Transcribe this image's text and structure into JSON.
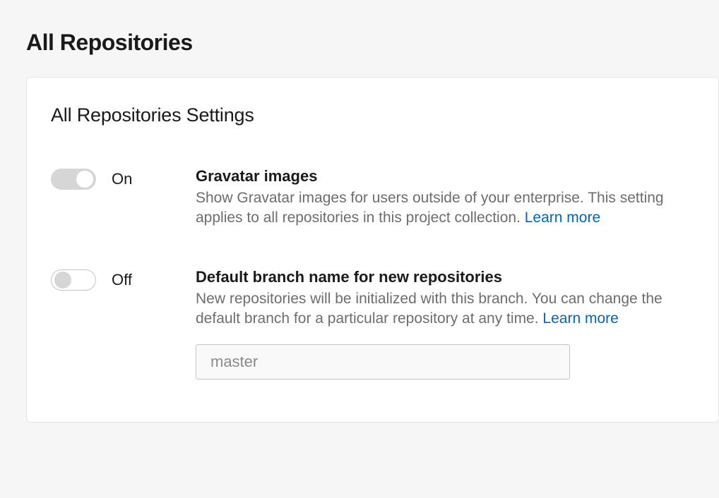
{
  "page": {
    "title": "All Repositories"
  },
  "card": {
    "title": "All Repositories Settings"
  },
  "settings": {
    "gravatar": {
      "toggle_state": "On",
      "title": "Gravatar images",
      "description": "Show Gravatar images for users outside of your enterprise. This setting applies to all repositories in this project collection. ",
      "learn_more": "Learn more"
    },
    "default_branch": {
      "toggle_state": "Off",
      "title": "Default branch name for new repositories",
      "description": "New repositories will be initialized with this branch. You can change the default branch for a particular repository at any time. ",
      "learn_more": "Learn more",
      "input_placeholder": "master",
      "input_value": ""
    }
  }
}
